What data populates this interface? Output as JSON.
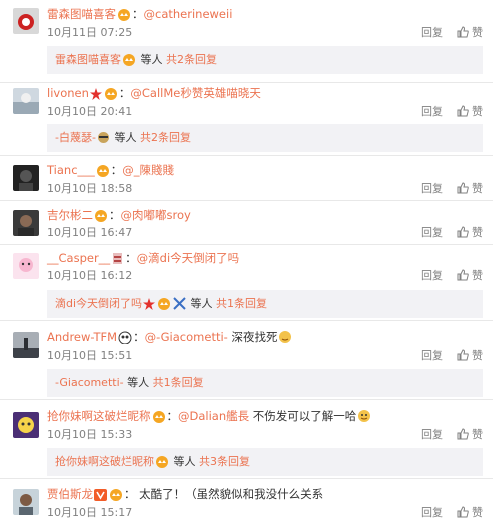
{
  "actions": {
    "reply": "回复",
    "like": "赞"
  },
  "comments": [
    {
      "user": "雷森图喵喜客",
      "mention": "@catherineweii",
      "content": "",
      "time": "10月11日 07:25",
      "sub": {
        "who": "雷森图喵喜客",
        "rest": " 等人",
        "count": " 共2条回复"
      }
    },
    {
      "user": "livonen",
      "mention": "@CallMe秒赞英雄喵晓天",
      "content": "",
      "time": "10月10日 20:41",
      "sub": {
        "who": "-白蔑瑟-",
        "rest": " 等人",
        "count": " 共2条回复"
      }
    },
    {
      "user": "Tianc___",
      "mention": "@_陳賤賤",
      "content": "",
      "time": "10月10日 18:58"
    },
    {
      "user": "吉尔彬二",
      "mention": "@肉嘟嘟sroy",
      "content": "",
      "time": "10月10日 16:47"
    },
    {
      "user": "__Casper__",
      "mention": "@滴di今天倒闭了吗",
      "content": "",
      "time": "10月10日 16:12",
      "sub": {
        "who": "滴di今天倒闭了吗",
        "rest": " 等人",
        "count": " 共1条回复"
      }
    },
    {
      "user": "Andrew-TFM",
      "mention": "@-Giacometti-",
      "content": " 深夜找死",
      "time": "10月10日 15:51",
      "sub": {
        "who": "-Giacometti-",
        "rest": " 等人",
        "count": " 共1条回复"
      }
    },
    {
      "user": "抢你妹啊这破烂昵称",
      "mention": "@Dalian艦長",
      "content": " 不伤发可以了解一哈",
      "time": "10月10日 15:33",
      "sub": {
        "who": "抢你妹啊这破烂昵称",
        "rest": " 等人",
        "count": " 共3条回复"
      }
    },
    {
      "user": "贾伯斯龙",
      "mention": "",
      "content": " 太酷了！（虽然貌似和我没什么关系",
      "time": "10月10日 15:17"
    }
  ],
  "colors": {
    "link": "#eb7350",
    "meta": "#808080",
    "subBg": "#f2f2f5"
  },
  "icons": [
    "avatar",
    "vip-crown-icon",
    "emoji-icon",
    "thumb-up-icon"
  ]
}
